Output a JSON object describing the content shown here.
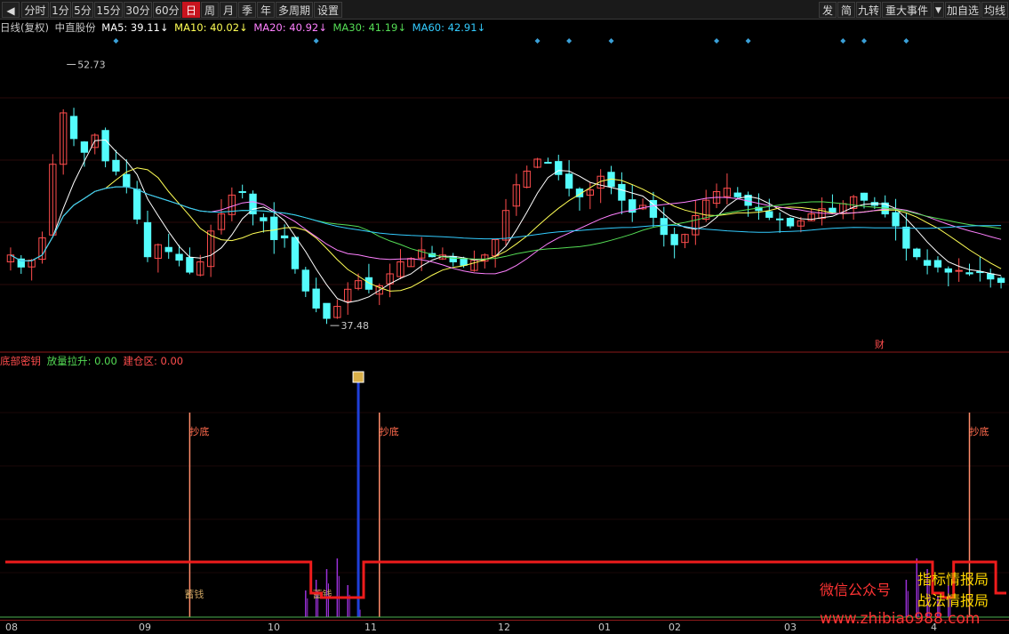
{
  "toolbar": {
    "back_icon": "back-arrow-icon",
    "periods": [
      "分时",
      "1分",
      "5分",
      "15分",
      "30分",
      "60分",
      "日",
      "周",
      "月",
      "季",
      "年",
      "多周期",
      "设置"
    ],
    "active_period": "日",
    "right_buttons": [
      "发",
      "简",
      "九转",
      "重大事件",
      "加自选",
      "均线"
    ],
    "dropdown_icon": "chevron-down-icon"
  },
  "info": {
    "title": "日线(复权)",
    "stock": "中直股份",
    "ma5": "MA5: 39.11↓",
    "ma10": "MA10: 40.02↓",
    "ma20": "MA20: 40.92↓",
    "ma30": "MA30: 41.19↓",
    "ma60": "MA60: 42.91↓"
  },
  "indicator": {
    "name": "底部密钥",
    "lift": "放量拉升: 0.00",
    "build": "建仓区: 0.00"
  },
  "annotations": {
    "high": "52.73",
    "low": "37.48",
    "cai": "财",
    "chaodi": "抄底",
    "xuqian": "蓄钱"
  },
  "watermark": {
    "wechat": "微信公众号",
    "name1": "指标情报局",
    "name2": "战法情报局",
    "url": "www.zhibiao988.com"
  },
  "xaxis": [
    "08",
    "09",
    "10",
    "11",
    "12",
    "01",
    "02",
    "03",
    "4"
  ],
  "colors": {
    "up": "#ff4d4d",
    "down": "#54fcfc",
    "ma5": "#ffffff",
    "ma10": "#ffff55",
    "ma20": "#ff80ff",
    "ma30": "#55dd55",
    "ma60": "#33ccff",
    "accent_red": "#c8141e"
  },
  "chart_data": {
    "type": "candlestick",
    "ylim": [
      36.5,
      54.0
    ],
    "price_high": 52.73,
    "price_low": 37.48,
    "closes": [
      41.6,
      40.9,
      41.3,
      42.6,
      46.9,
      49.9,
      48.4,
      47.6,
      48.6,
      47.1,
      46.5,
      45.6,
      43.7,
      41.5,
      42.2,
      41.8,
      41.3,
      40.6,
      41.2,
      43.0,
      44.0,
      45.1,
      45.3,
      44.0,
      43.6,
      42.5,
      42.6,
      40.8,
      39.5,
      38.5,
      37.9,
      38.6,
      39.6,
      40.1,
      39.6,
      39.8,
      40.5,
      41.2,
      41.4,
      41.9,
      41.5,
      41.6,
      41.2,
      41.0,
      41.3,
      41.6,
      42.5,
      44.2,
      45.7,
      46.5,
      47.2,
      47.0,
      46.3,
      45.5,
      45.0,
      45.4,
      46.2,
      45.6,
      44.8,
      44.1,
      44.5,
      43.8,
      42.8,
      42.2,
      42.8,
      43.9,
      44.8,
      45.3,
      45.5,
      45.0,
      44.5,
      44.2,
      43.8,
      43.7,
      43.3,
      43.6,
      44.0,
      44.3,
      44.1,
      44.6,
      45.0,
      44.8,
      44.5,
      44.0,
      43.3,
      42.0,
      41.5,
      41.0,
      40.9,
      40.6,
      40.7,
      40.5,
      40.6,
      40.2,
      40.0
    ]
  },
  "sub_data": {
    "state_line": [
      1,
      1,
      1,
      1,
      1,
      1,
      1,
      1,
      1,
      1,
      1,
      1,
      1,
      1,
      1,
      1,
      1,
      1,
      1,
      1,
      1,
      1,
      1,
      1,
      1,
      1,
      1,
      1,
      1,
      0.3,
      0.2,
      0.2,
      0.2,
      0.2,
      1,
      1,
      1,
      1,
      1,
      1,
      1,
      1,
      1,
      1,
      1,
      1,
      1,
      1,
      1,
      1,
      1,
      1,
      1,
      1,
      1,
      1,
      1,
      1,
      1,
      1,
      1,
      1,
      1,
      1,
      1,
      1,
      1,
      1,
      1,
      1,
      1,
      1,
      1,
      1,
      1,
      1,
      1,
      1,
      1,
      1,
      1,
      1,
      1,
      1,
      1,
      1,
      1,
      1,
      0.3,
      0.2,
      1,
      1,
      1,
      1,
      0.3
    ],
    "purple_bars": [
      0,
      0,
      0,
      0,
      0,
      0,
      0,
      0,
      0,
      0,
      0,
      0,
      0,
      0,
      0,
      0,
      0,
      0,
      0,
      0,
      0,
      0,
      0,
      0,
      0,
      0,
      0,
      0,
      0.25,
      0.35,
      0.45,
      0.55,
      0.3,
      0.1,
      0,
      0,
      0,
      0,
      0,
      0,
      0,
      0,
      0,
      0,
      0,
      0,
      0,
      0,
      0,
      0,
      0,
      0,
      0,
      0,
      0,
      0,
      0,
      0,
      0,
      0,
      0,
      0,
      0,
      0,
      0,
      0,
      0,
      0,
      0,
      0,
      0,
      0,
      0,
      0,
      0,
      0,
      0,
      0,
      0,
      0,
      0,
      0,
      0,
      0,
      0,
      0.35,
      0.55,
      0.45,
      0.2,
      0.3,
      0,
      0,
      0,
      0,
      0
    ],
    "signals": [
      {
        "index": 17,
        "type": "chaodi"
      },
      {
        "index": 35,
        "type": "chaodi"
      },
      {
        "index": 91,
        "type": "chaodi"
      },
      {
        "index": 33,
        "type": "blue"
      }
    ]
  }
}
